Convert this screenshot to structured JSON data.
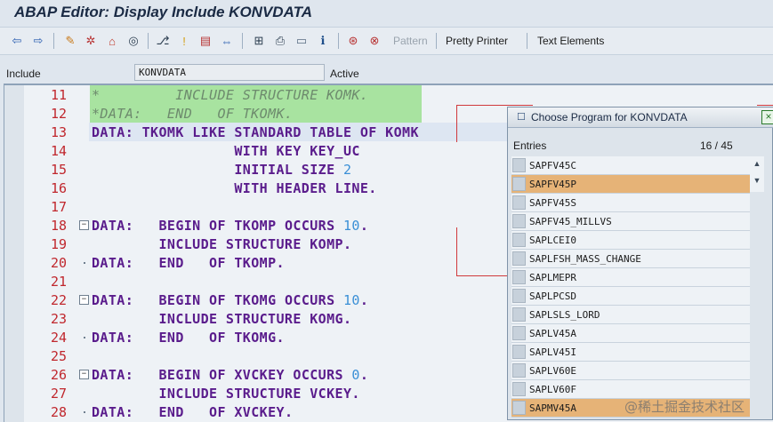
{
  "window": {
    "title": "ABAP Editor: Display Include KONVDATA"
  },
  "toolbar": {
    "icons": [
      "back-arrow-icon",
      "forward-arrow-icon",
      "display-change-icon",
      "other-object-icon",
      "activate-icon",
      "check-icon",
      "where-used-icon",
      "navigation-icon",
      "breakpoint-icon",
      "window-icon",
      "move-icon",
      "hierarchy-icon",
      "print-icon",
      "block-icon",
      "info-icon",
      "breakpoint-set-icon",
      "delete-breakpoint-icon"
    ],
    "pattern_label": "Pattern",
    "pretty_printer_label": "Pretty Printer",
    "text_elements_label": "Text Elements"
  },
  "include_row": {
    "label": "Include",
    "value": "KONVDATA",
    "status": "Active"
  },
  "editor": {
    "lines": [
      {
        "num": "11",
        "text": "*         INCLUDE STRUCTURE KOMK.",
        "comment": true,
        "fold": ""
      },
      {
        "num": "12",
        "text": "*DATA:   END   OF TKOMK.",
        "comment": true,
        "fold": ""
      },
      {
        "num": "13",
        "text": "DATA: TKOMK LIKE STANDARD TABLE OF KOMK",
        "comment": false,
        "fold": ""
      },
      {
        "num": "14",
        "text": "                 WITH KEY KEY_UC",
        "comment": false,
        "fold": ""
      },
      {
        "num": "15",
        "text": "                 INITIAL SIZE 2",
        "comment": false,
        "fold": ""
      },
      {
        "num": "16",
        "text": "                 WITH HEADER LINE.",
        "comment": false,
        "fold": ""
      },
      {
        "num": "17",
        "text": "",
        "comment": false,
        "fold": ""
      },
      {
        "num": "18",
        "text": "DATA:   BEGIN OF TKOMP OCCURS 10.",
        "comment": false,
        "fold": "minus"
      },
      {
        "num": "19",
        "text": "        INCLUDE STRUCTURE KOMP.",
        "comment": false,
        "fold": ""
      },
      {
        "num": "20",
        "text": "DATA:   END   OF TKOMP.",
        "comment": false,
        "fold": "dot"
      },
      {
        "num": "21",
        "text": "",
        "comment": false,
        "fold": ""
      },
      {
        "num": "22",
        "text": "DATA:   BEGIN OF TKOMG OCCURS 10.",
        "comment": false,
        "fold": "minus"
      },
      {
        "num": "23",
        "text": "        INCLUDE STRUCTURE KOMG.",
        "comment": false,
        "fold": ""
      },
      {
        "num": "24",
        "text": "DATA:   END   OF TKOMG.",
        "comment": false,
        "fold": "dot"
      },
      {
        "num": "25",
        "text": "",
        "comment": false,
        "fold": ""
      },
      {
        "num": "26",
        "text": "DATA:   BEGIN OF XVCKEY OCCURS 0.",
        "comment": false,
        "fold": "minus"
      },
      {
        "num": "27",
        "text": "        INCLUDE STRUCTURE VCKEY.",
        "comment": false,
        "fold": ""
      },
      {
        "num": "28",
        "text": "DATA:   END   OF XVCKEY.",
        "comment": false,
        "fold": "dot"
      }
    ]
  },
  "popup": {
    "title": "Choose Program for KONVDATA",
    "entries_label": "Entries",
    "entries_count": "16 / 45",
    "items": [
      {
        "name": "SAPFV45C",
        "selected": false
      },
      {
        "name": "SAPFV45P",
        "selected": true
      },
      {
        "name": "SAPFV45S",
        "selected": false
      },
      {
        "name": "SAPFV45_MILLVS",
        "selected": false
      },
      {
        "name": "SAPLCEI0",
        "selected": false
      },
      {
        "name": "SAPLFSH_MASS_CHANGE",
        "selected": false
      },
      {
        "name": "SAPLMEPR",
        "selected": false
      },
      {
        "name": "SAPLPCSD",
        "selected": false
      },
      {
        "name": "SAPLSLS_LORD",
        "selected": false
      },
      {
        "name": "SAPLV45A",
        "selected": false
      },
      {
        "name": "SAPLV45I",
        "selected": false
      },
      {
        "name": "SAPLV60E",
        "selected": false
      },
      {
        "name": "SAPLV60F",
        "selected": false
      },
      {
        "name": "SAPMV45A",
        "selected": true
      }
    ]
  },
  "watermark": "@稀土掘金技术社区"
}
